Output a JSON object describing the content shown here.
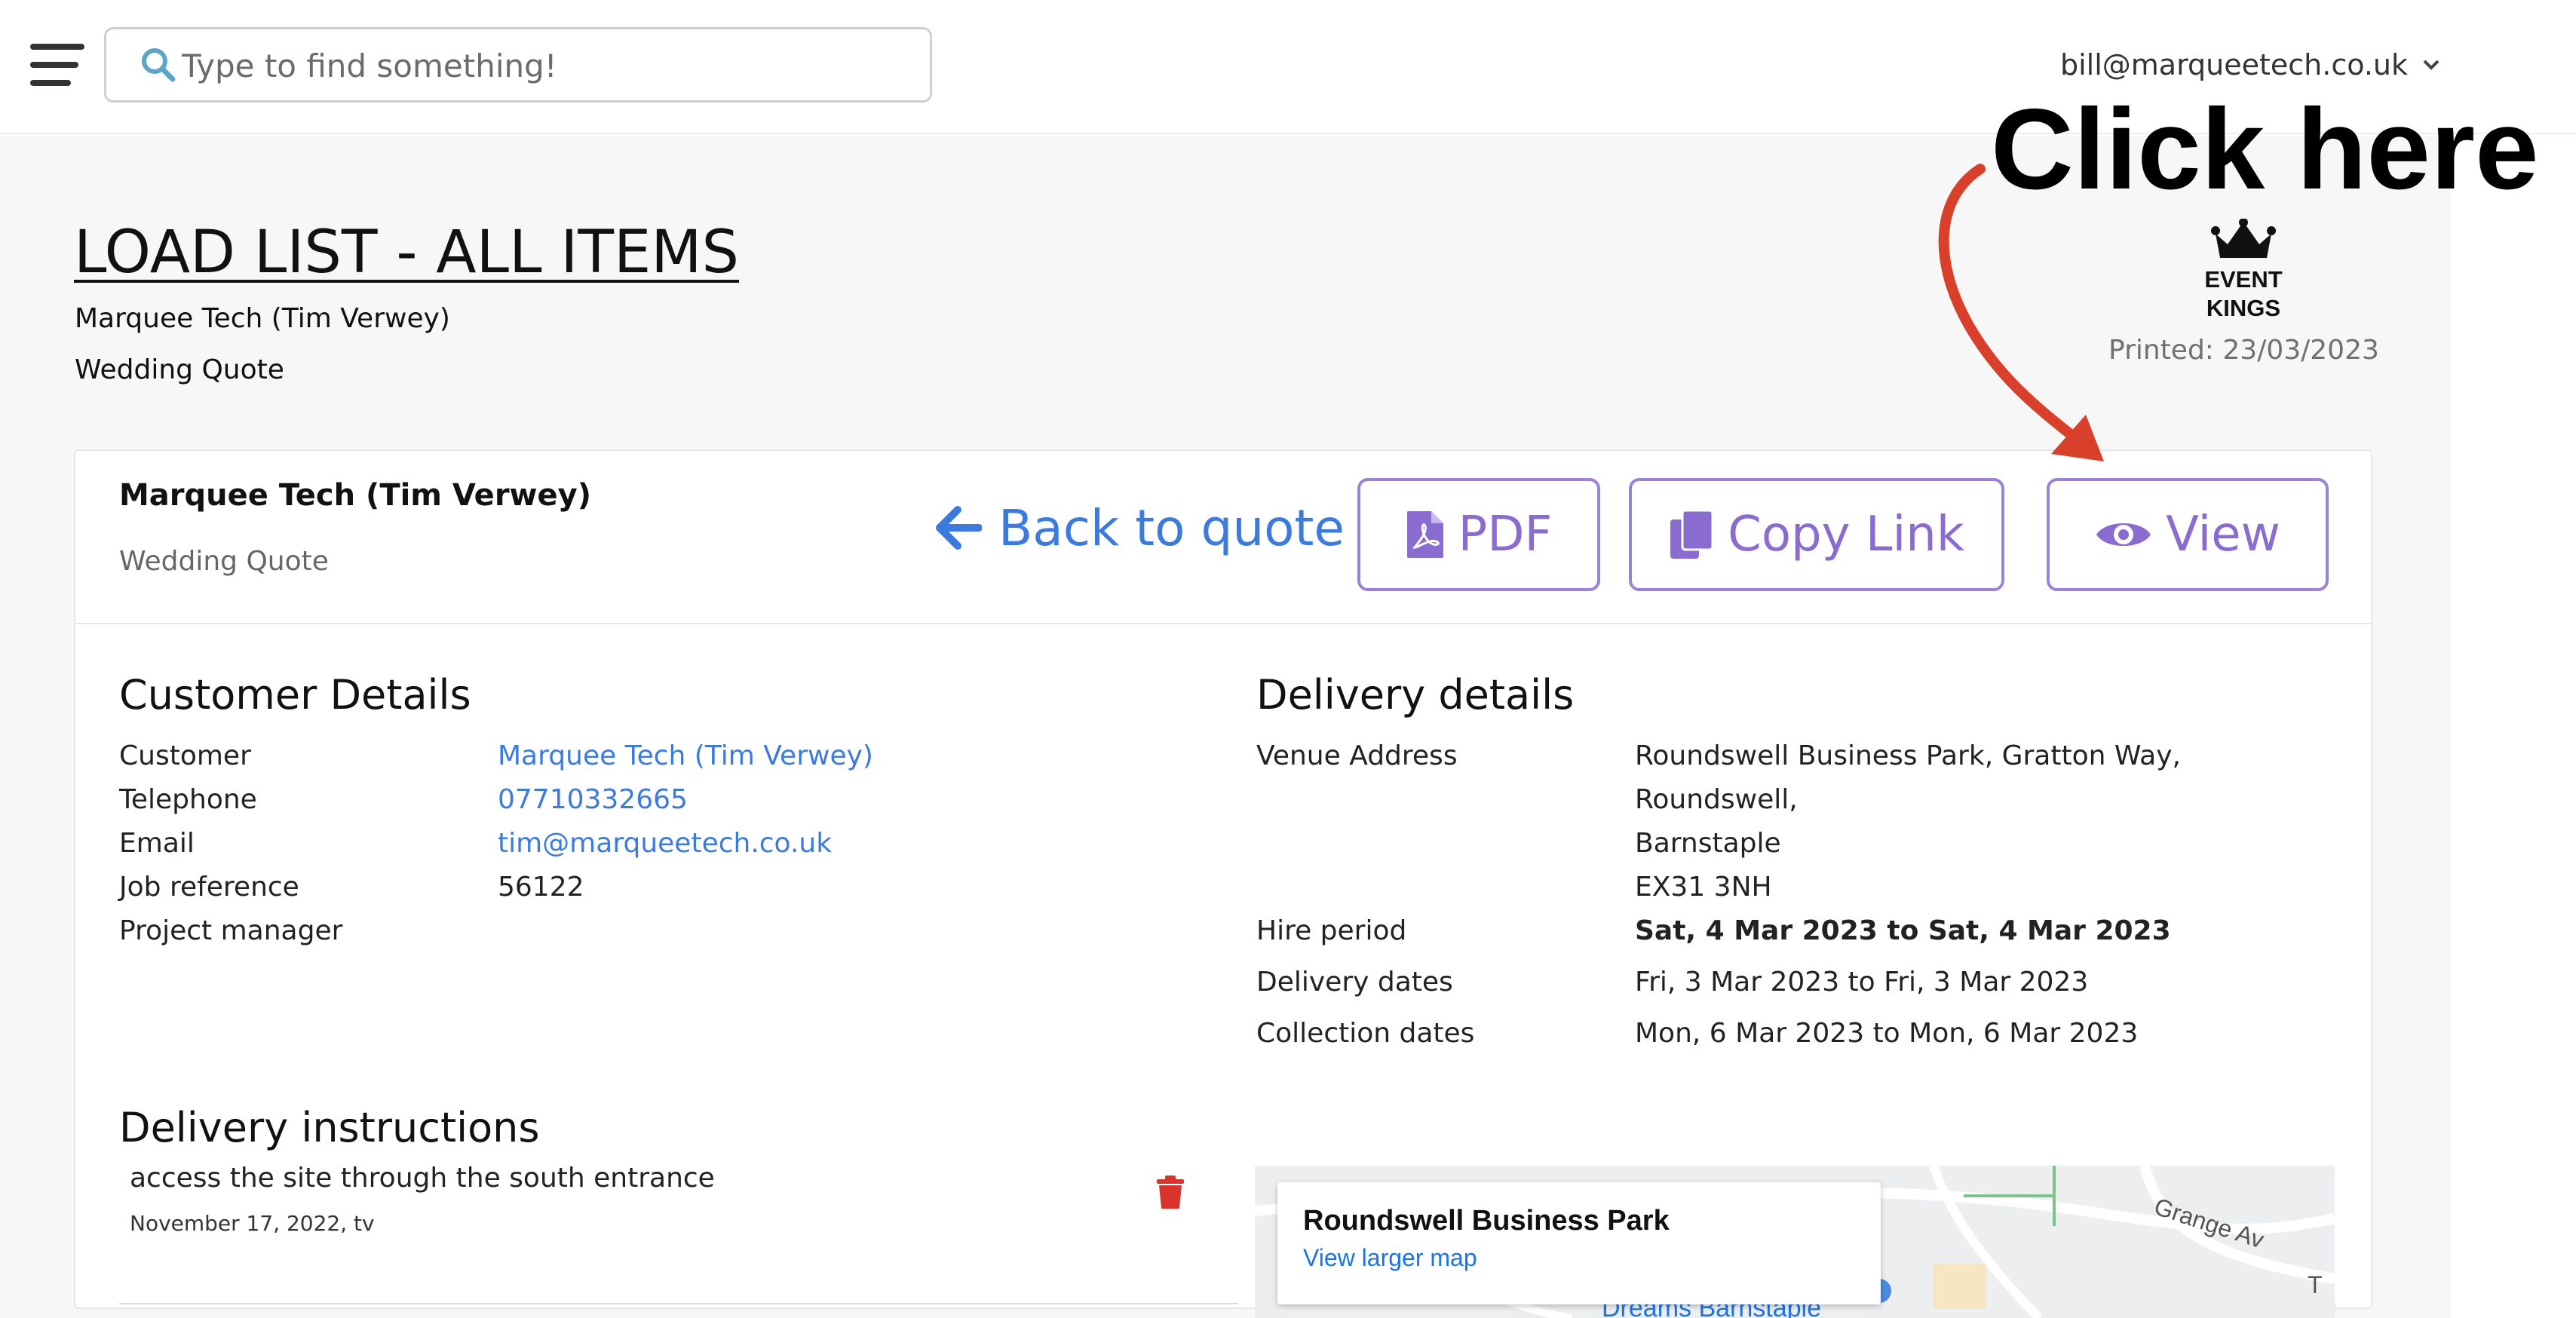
{
  "header": {
    "search_placeholder": "Type to find something!",
    "user_email": "bill@marqueetech.co.uk"
  },
  "page": {
    "title": "LOAD LIST - ALL ITEMS",
    "company": "Marquee Tech (Tim Verwey)",
    "quote_name": "Wedding Quote",
    "logo_line1": "EVENT",
    "logo_line2": "KINGS",
    "printed": "Printed: 23/03/2023"
  },
  "annotation": {
    "text": "Click here",
    "color": "#d9402b"
  },
  "card": {
    "company": "Marquee Tech (Tim Verwey)",
    "quote_name": "Wedding Quote",
    "back_label": "Back to quote",
    "pdf_label": "PDF",
    "copy_label": "Copy Link",
    "view_label": "View"
  },
  "customer": {
    "title": "Customer Details",
    "rows": [
      {
        "label": "Customer",
        "value": "Marquee Tech (Tim Verwey)"
      },
      {
        "label": "Telephone",
        "value": "07710332665"
      },
      {
        "label": "Email",
        "value": "tim@marqueetech.co.uk"
      },
      {
        "label": "Job reference",
        "value": "56122"
      },
      {
        "label": "Project manager",
        "value": ""
      }
    ]
  },
  "delivery": {
    "title": "Delivery details",
    "venue_label": "Venue Address",
    "venue_lines": [
      "Roundswell Business Park, Gratton Way,",
      "Roundswell,",
      "Barnstaple",
      "EX31 3NH"
    ],
    "hire_label": "Hire period",
    "hire_value": "Sat, 4 Mar 2023 to Sat, 4 Mar 2023",
    "delivery_label": "Delivery dates",
    "delivery_value": "Fri, 3 Mar 2023 to Fri, 3 Mar 2023",
    "collection_label": "Collection dates",
    "collection_value": "Mon, 6 Mar 2023 to Mon, 6 Mar 2023"
  },
  "instructions": {
    "title": "Delivery instructions",
    "items": [
      {
        "text": "access the site through the south entrance",
        "meta": "November 17, 2022, tv"
      }
    ]
  },
  "map": {
    "place_title": "Roundswell Business Park",
    "larger_map_label": "View larger map",
    "road_label": "Grange Av",
    "poi_label": "Dreams Barnstaple",
    "edge_label": "T"
  },
  "colors": {
    "accent": "#3b7be0",
    "button_purple": "#9c82d6",
    "delete_red": "#d9342b"
  }
}
